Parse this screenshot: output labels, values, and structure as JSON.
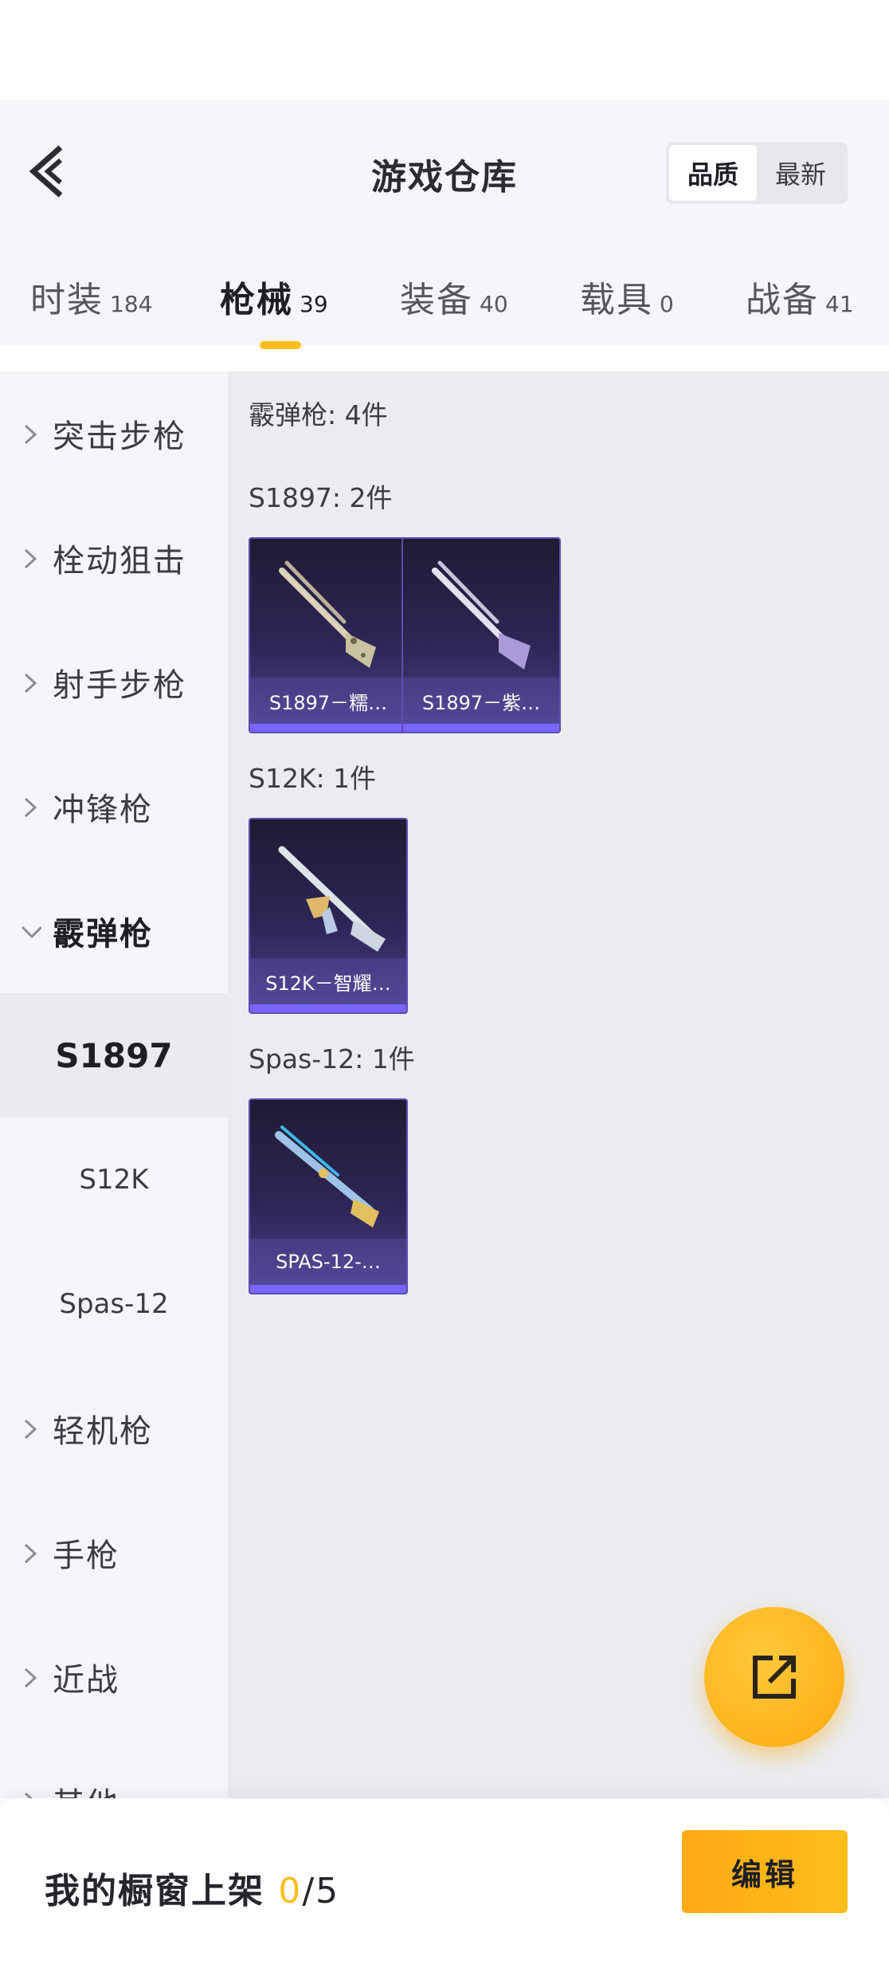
{
  "header": {
    "title": "游戏仓库",
    "sort_options": [
      {
        "label": "品质",
        "active": true
      },
      {
        "label": "最新",
        "active": false
      }
    ]
  },
  "tabs": [
    {
      "label": "时装",
      "count": "184",
      "active": false
    },
    {
      "label": "枪械",
      "count": "39",
      "active": true
    },
    {
      "label": "装备",
      "count": "40",
      "active": false
    },
    {
      "label": "载具",
      "count": "0",
      "active": false
    },
    {
      "label": "战备",
      "count": "41",
      "active": false
    }
  ],
  "sidebar": {
    "categories": [
      {
        "label": "突击步枪",
        "expanded": false
      },
      {
        "label": "栓动狙击",
        "expanded": false
      },
      {
        "label": "射手步枪",
        "expanded": false
      },
      {
        "label": "冲锋枪",
        "expanded": false
      },
      {
        "label": "霰弹枪",
        "expanded": true
      },
      {
        "label": "轻机枪",
        "expanded": false
      },
      {
        "label": "手枪",
        "expanded": false
      },
      {
        "label": "近战",
        "expanded": false
      },
      {
        "label": "其他",
        "expanded": false
      }
    ],
    "subitems": [
      {
        "label": "S1897",
        "active": true
      },
      {
        "label": "S12K",
        "active": false
      },
      {
        "label": "Spas-12",
        "active": false
      }
    ]
  },
  "content": {
    "category_title": "霰弹枪: 4件",
    "groups": [
      {
        "title": "S1897: 2件",
        "items": [
          {
            "name": "S1897－糯…",
            "icon": "shotgun-camo-icon"
          },
          {
            "name": "S1897－紫…",
            "icon": "shotgun-purple-icon"
          }
        ]
      },
      {
        "title": "S12K: 1件",
        "items": [
          {
            "name": "S12K－智耀…",
            "icon": "rifle-silver-icon"
          }
        ]
      },
      {
        "title": "Spas-12: 1件",
        "items": [
          {
            "name": "SPAS-12-…",
            "icon": "shotgun-blue-icon"
          }
        ]
      }
    ]
  },
  "bottom": {
    "shelf_label": "我的橱窗上架",
    "shelf_current": "0",
    "shelf_total": "/5",
    "edit_label": "编辑"
  },
  "colors": {
    "accent": "#ffbe19",
    "card_border": "#5a4fb0",
    "card_bar": "#7a64ff"
  }
}
